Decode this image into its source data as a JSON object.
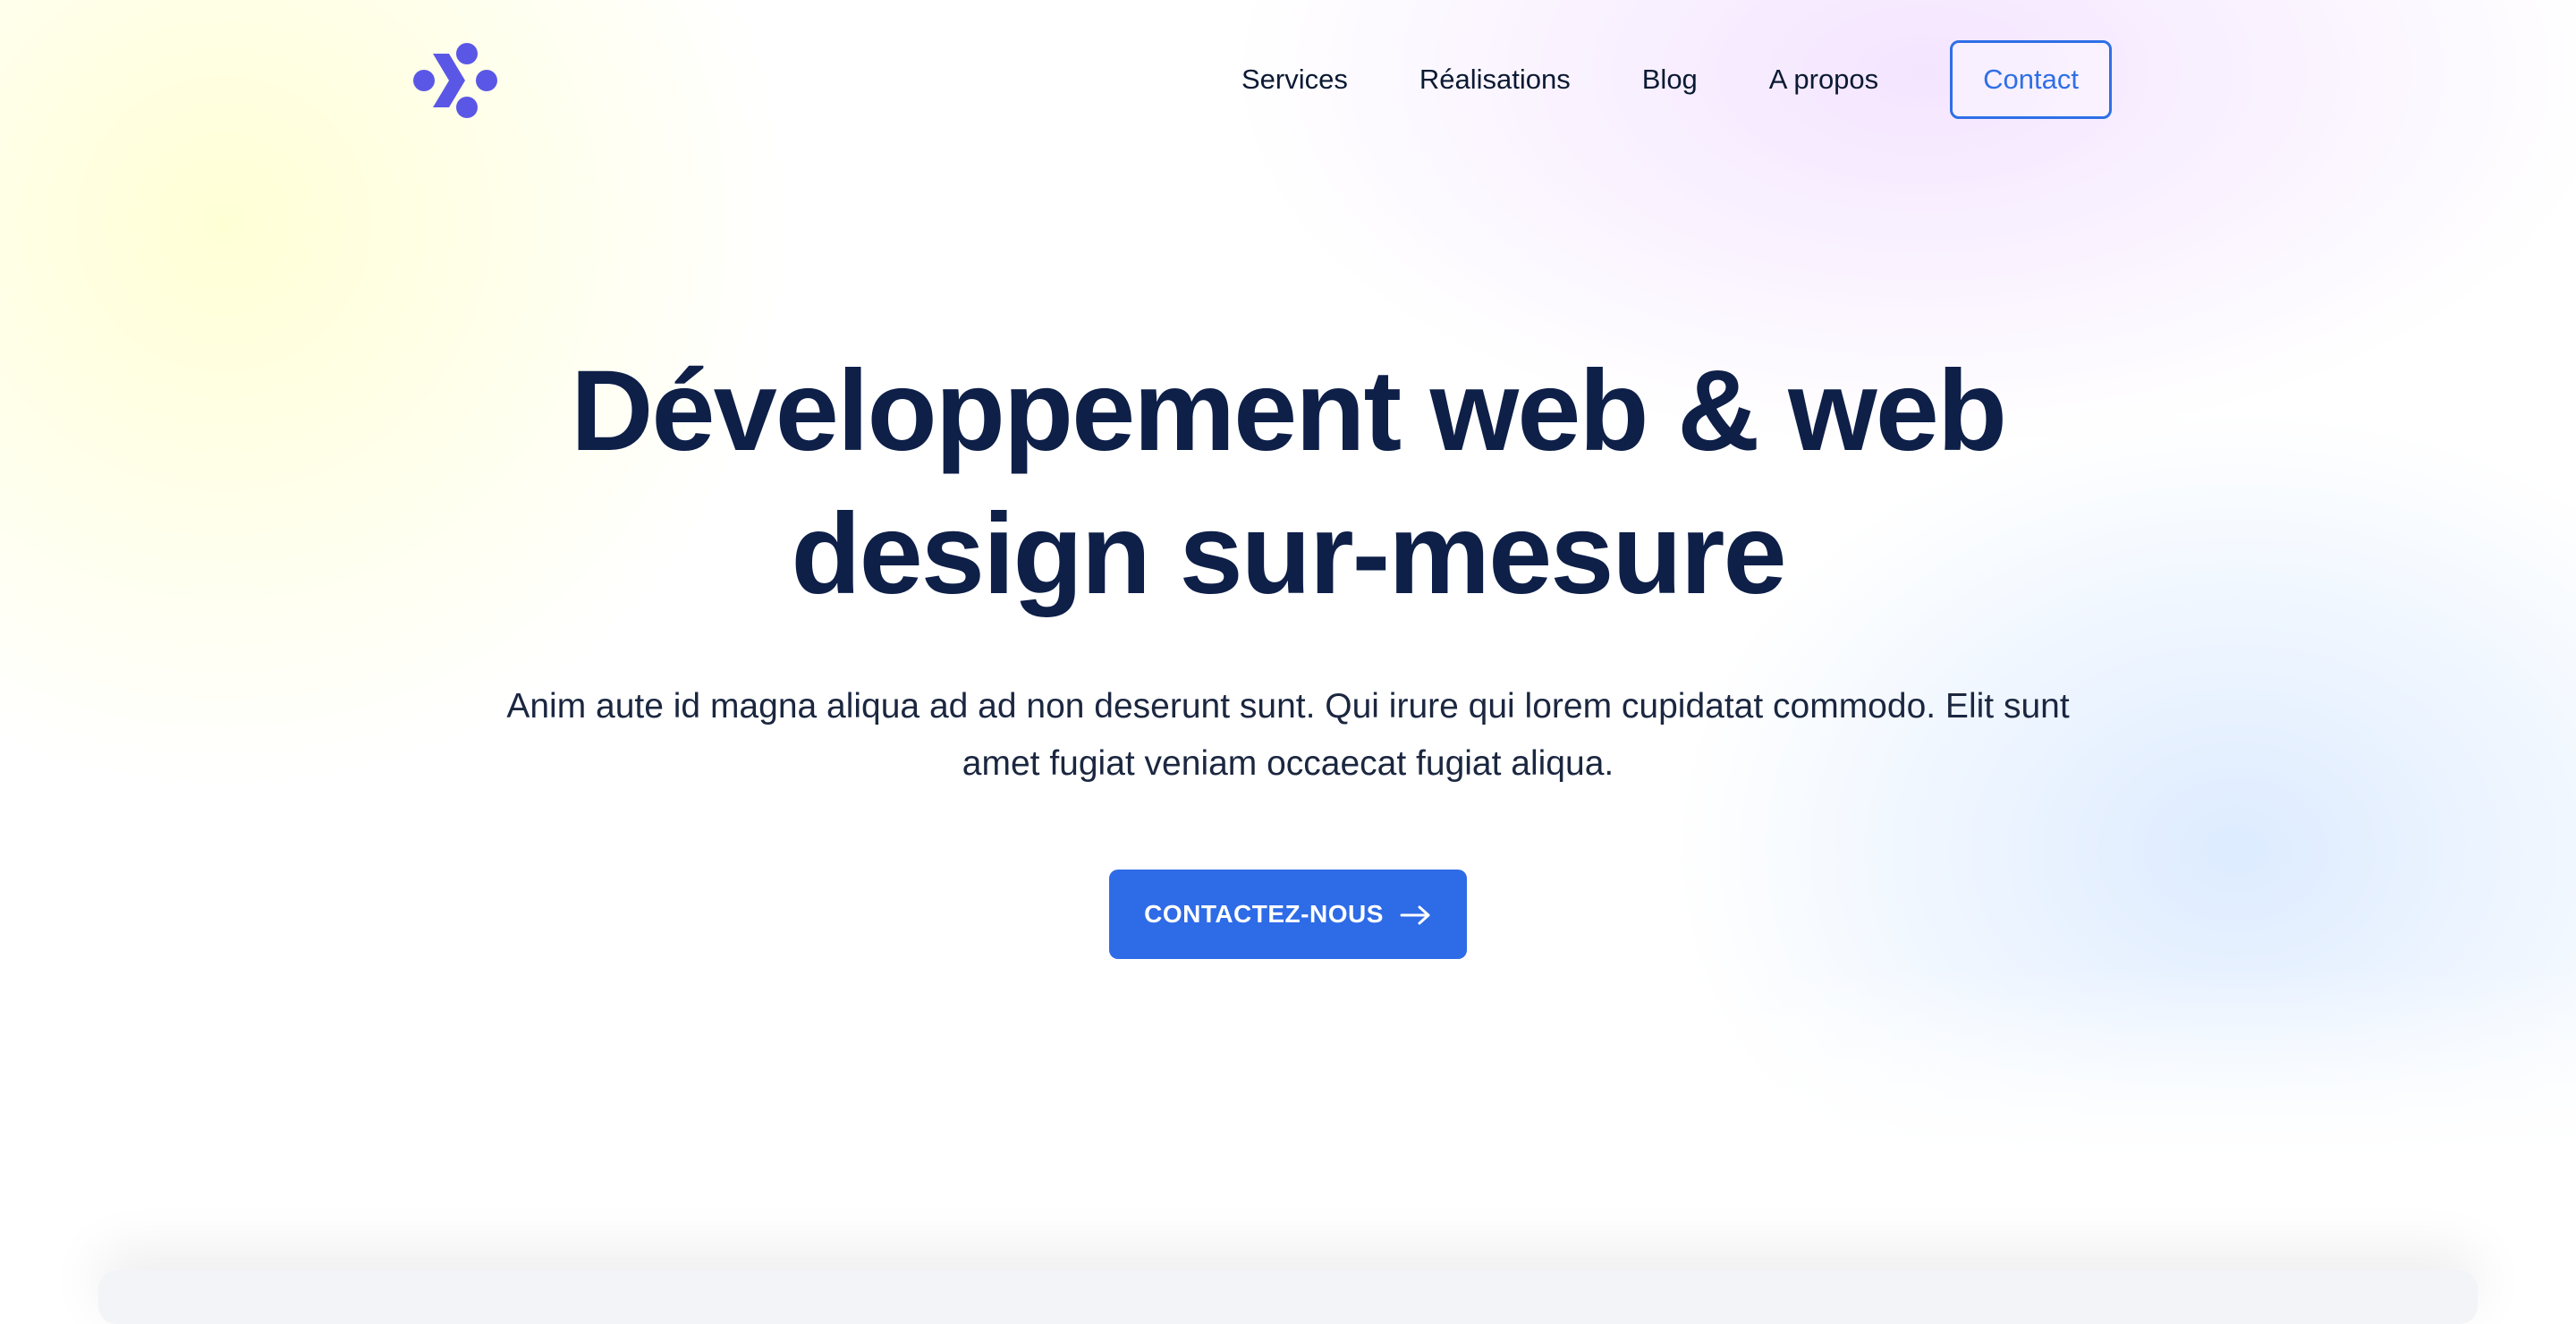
{
  "header": {
    "logo_icon": "brand-logo-icon",
    "nav": [
      {
        "label": "Services"
      },
      {
        "label": "Réalisations"
      },
      {
        "label": "Blog"
      },
      {
        "label": "A propos"
      }
    ],
    "contact_label": "Contact"
  },
  "hero": {
    "title": "Développement web & web design sur-mesure",
    "subtitle": "Anim aute id magna aliqua ad ad non deserunt sunt. Qui irure qui lorem cupidatat commodo. Elit sunt amet fugiat veniam occaecat fugiat aliqua.",
    "cta_label": "CONTACTEZ-NOUS",
    "cta_icon": "arrow-right-icon"
  },
  "colors": {
    "accent": "#2e6be7",
    "logo": "#5b57e6",
    "title": "#0e1f48"
  }
}
